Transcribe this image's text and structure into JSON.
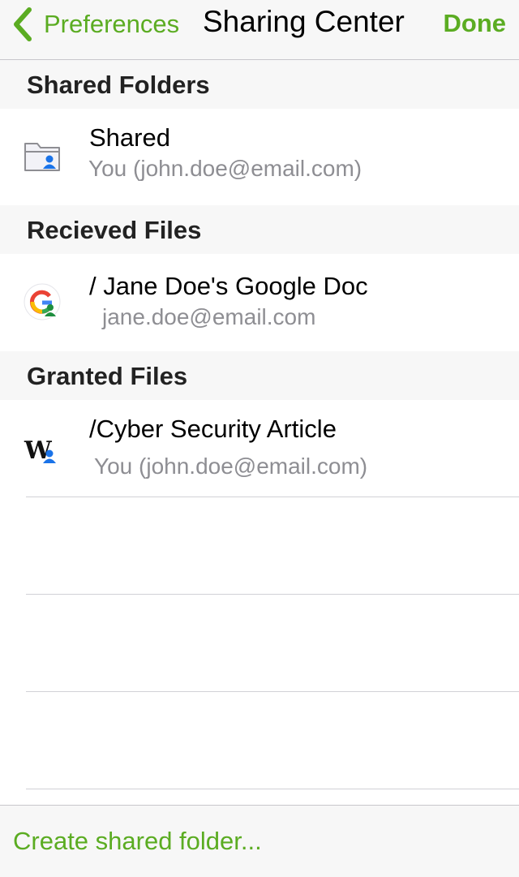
{
  "navbar": {
    "back_label": "Preferences",
    "title": "Sharing Center",
    "done_label": "Done"
  },
  "sections": [
    {
      "header": "Shared Folders",
      "item": {
        "icon": "shared-folder-icon",
        "title": "Shared",
        "subtitle": "You (john.doe@email.com)"
      }
    },
    {
      "header": "Recieved Files",
      "item": {
        "icon": "google-doc-icon",
        "title": "/ Jane Doe's Google Doc",
        "subtitle": "jane.doe@email.com"
      }
    },
    {
      "header": "Granted Files",
      "item": {
        "icon": "word-doc-icon",
        "title": "/Cyber Security Article",
        "subtitle": "You (john.doe@email.com)"
      }
    }
  ],
  "toolbar": {
    "create_label": "Create shared folder..."
  },
  "colors": {
    "accent": "#5bac22",
    "header_bg": "#f7f7f7",
    "secondary_text": "#8e8e93"
  }
}
